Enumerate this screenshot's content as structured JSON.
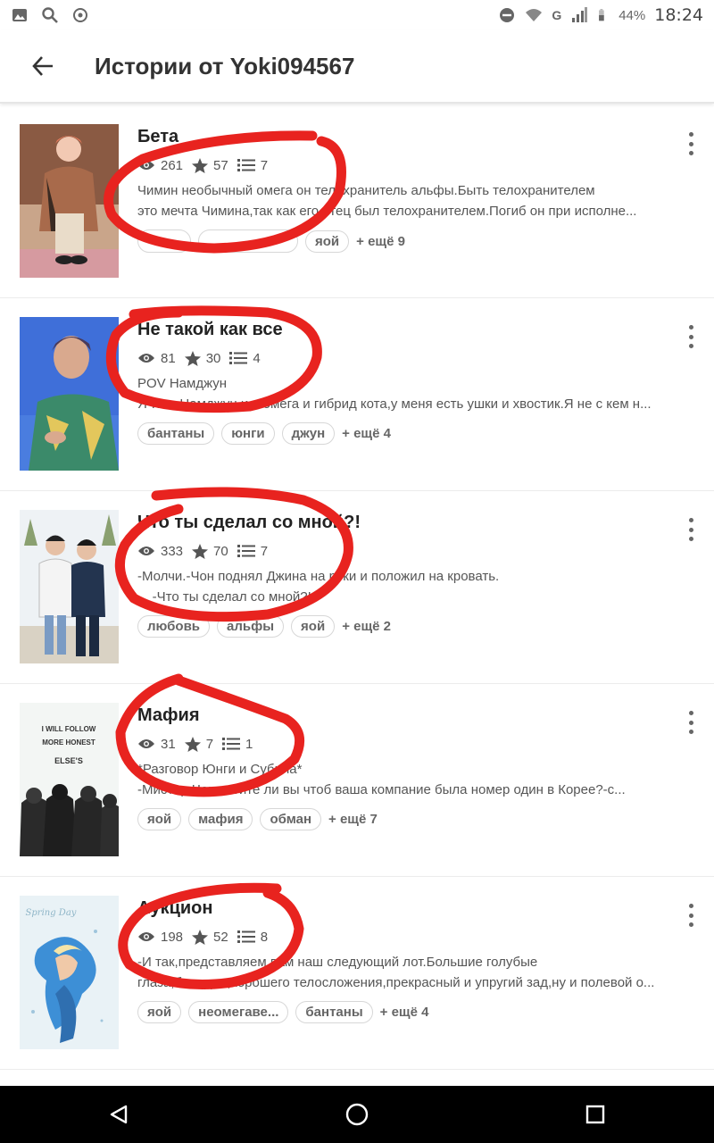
{
  "status_bar": {
    "signal_label": "G",
    "battery": "44%",
    "time": "18:24",
    "icons": [
      "image-icon",
      "search-icon",
      "location-icon",
      "dnd-icon",
      "wifi-icon",
      "signal-icon",
      "battery-icon"
    ]
  },
  "app_bar": {
    "title": "Истории от Yoki094567",
    "back_icon": "arrow-left-icon"
  },
  "accent_color": "#e8231f",
  "stories": [
    {
      "title": "Бета",
      "views": "261",
      "stars": "57",
      "parts": "7",
      "desc_line1": "Чимин необычный омега он телохранитель альфы.Быть телохранителем",
      "desc_line2": "это мечта Чимина,так как его отец был телохранителем.Погиб он при исполне...",
      "tags": [
        "",
        "",
        "яой"
      ],
      "more": "+ ещё 9"
    },
    {
      "title": "Не такой как все",
      "views": "81",
      "stars": "30",
      "parts": "4",
      "desc_line1": "POV Намджун",
      "desc_line2": "Я-Ким Намджун,и я омега и гибрид кота,у меня есть ушки и хвостик.Я не с кем н...",
      "tags": [
        "бантаны",
        "юнги",
        "джун"
      ],
      "more": "+ ещё 4"
    },
    {
      "title": "Что ты сделал со мной?!",
      "views": "333",
      "stars": "70",
      "parts": "7",
      "desc_line1": "-Молчи.-Чон поднял Джина на руки и положил на кровать.",
      "desc_line2": "    -Что ты сделал со мной?!",
      "tags": [
        "любовь",
        "альфы",
        "яой"
      ],
      "more": "+ ещё 2"
    },
    {
      "title": "Мафия",
      "views": "31",
      "stars": "7",
      "parts": "1",
      "desc_line1": "*Разговор Юнги и Субина*",
      "desc_line2": "-Мистер Чон,хотите ли вы чтоб ваша компание была номер один в Корее?-с...",
      "tags": [
        "яой",
        "мафия",
        "обман"
      ],
      "more": "+ ещё 7"
    },
    {
      "title": "Аукцион",
      "views": "198",
      "stars": "52",
      "parts": "8",
      "desc_line1": "-И так,представляем вам наш следующий лот.Большие голубые",
      "desc_line2": "глаза,блондин,хорошего телосложения,прекрасный и упругий зад,ну и полевой о...",
      "tags": [
        "яой",
        "неомегаве...",
        "бантаны"
      ],
      "more": "+ ещё 4"
    }
  ],
  "covers": [
    {
      "caption": ""
    },
    {
      "caption": ""
    },
    {
      "caption": ""
    },
    {
      "caption_line1": "I WILL FOLLOW",
      "caption_line2": "MORE HONEST",
      "caption_line3": "ELSE'S"
    },
    {
      "caption": "Spring Day"
    }
  ],
  "nav_bar": {
    "icons": [
      "back-triangle-icon",
      "home-circle-icon",
      "recents-square-icon"
    ]
  }
}
